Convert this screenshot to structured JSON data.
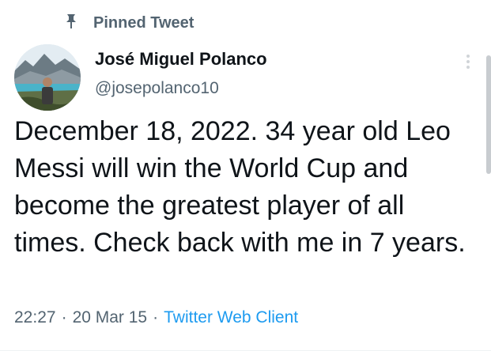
{
  "pinned": {
    "icon": "pin-icon",
    "label": "Pinned Tweet"
  },
  "author": {
    "display_name": "José Miguel Polanco",
    "handle": "@josepolanco10"
  },
  "tweet": {
    "text": "December 18, 2022. 34 year old Leo Messi will win the World Cup and become the greatest player of all times. Check back with me in 7 years.",
    "time": "22:27",
    "separator": "·",
    "date": "20 Mar 15",
    "source": "Twitter Web Client"
  },
  "colors": {
    "primary_text": "#0f1419",
    "secondary_text": "#536471",
    "link": "#1d9bf0"
  }
}
